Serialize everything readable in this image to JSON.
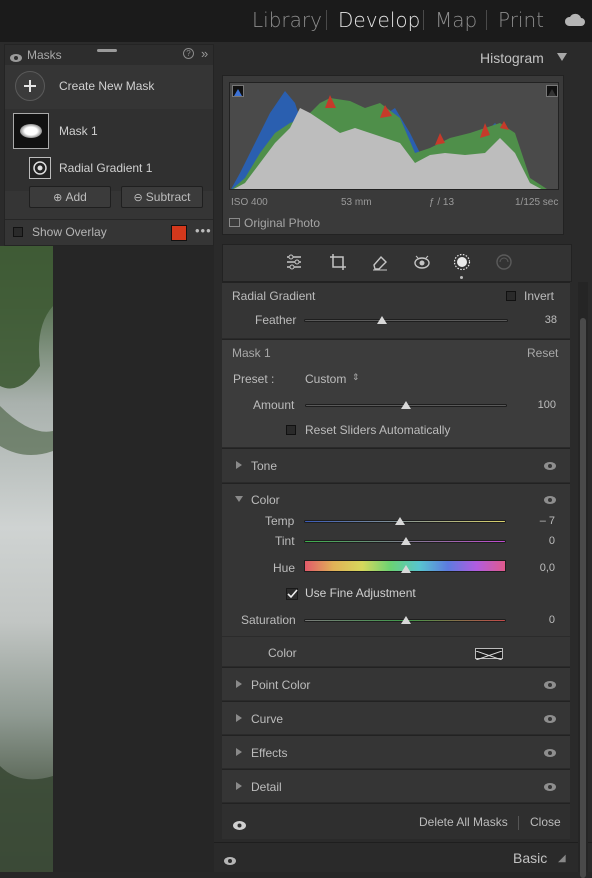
{
  "modules": {
    "library": "Library",
    "develop": "Develop",
    "map": "Map",
    "print": "Print"
  },
  "masks": {
    "title": "Masks",
    "create_label": "Create New Mask",
    "mask1": "Mask 1",
    "radial": "Radial Gradient 1",
    "add": "Add",
    "subtract": "Subtract",
    "show_overlay": "Show Overlay",
    "overlay_color": "#d3381c"
  },
  "histogram": {
    "title": "Histogram",
    "iso": "ISO 400",
    "focal": "53 mm",
    "aperture": "ƒ / 13",
    "shutter": "1/125 sec",
    "original_photo": "Original Photo"
  },
  "radial": {
    "title": "Radial Gradient",
    "invert": "Invert",
    "feather_label": "Feather",
    "feather_value": "38",
    "feather": 38
  },
  "mask": {
    "title": "Mask 1",
    "reset": "Reset",
    "preset_label": "Preset :",
    "preset_value": "Custom",
    "amount_label": "Amount",
    "amount_value": "100",
    "amount": 100,
    "reset_sliders": "Reset Sliders Automatically"
  },
  "tone": {
    "label": "Tone"
  },
  "color": {
    "label": "Color",
    "temp_label": "Temp",
    "temp_value": "– 7",
    "tint_label": "Tint",
    "tint_value": "0",
    "hue_label": "Hue",
    "hue_value": "0,0",
    "fine_adjust": "Use Fine Adjustment",
    "sat_label": "Saturation",
    "sat_value": "0",
    "color_label": "Color"
  },
  "sections": {
    "point_color": "Point Color",
    "curve": "Curve",
    "effects": "Effects",
    "detail": "Detail"
  },
  "footer": {
    "delete_all": "Delete All Masks",
    "close": "Close"
  },
  "basic": {
    "label": "Basic"
  }
}
